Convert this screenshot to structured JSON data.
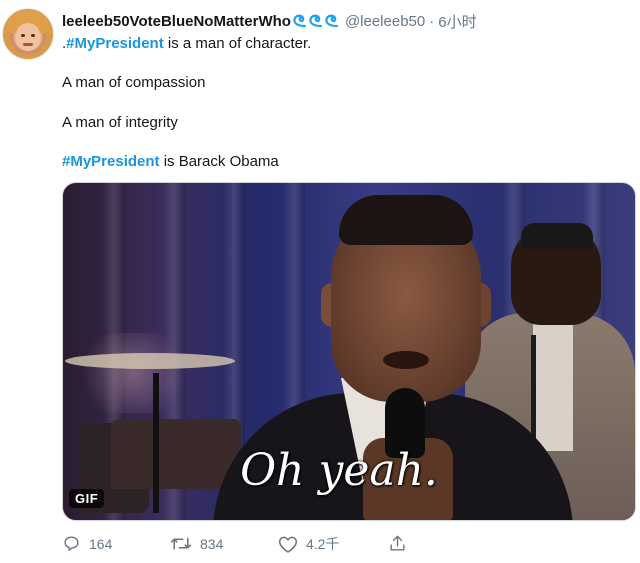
{
  "tweet": {
    "display_name": "leeleeb50VoteBlueNoMatterWho",
    "handle": "@leeleeb50",
    "separator": "·",
    "time": "6小时",
    "name_icons": [
      "wave-icon",
      "wave-icon",
      "wave-icon"
    ],
    "lines": [
      {
        "prefix": ".",
        "hashtag": "#MyPresident",
        "text": " is a man of character."
      },
      {
        "text": "A man of compassion"
      },
      {
        "text": "A man of integrity"
      },
      {
        "hashtag": "#MyPresident",
        "text": " is Barack Obama"
      }
    ],
    "media": {
      "caption": "Oh yeah.",
      "badge": "GIF"
    },
    "actions": {
      "reply": {
        "icon": "reply-icon",
        "count": "164"
      },
      "retweet": {
        "icon": "retweet-icon",
        "count": "834"
      },
      "like": {
        "icon": "heart-icon",
        "count": "4.2千"
      },
      "share": {
        "icon": "share-icon"
      }
    }
  },
  "colors": {
    "link": "#1b95e0",
    "muted": "#657786",
    "text": "#14171a",
    "wave": "#1da1f2"
  }
}
